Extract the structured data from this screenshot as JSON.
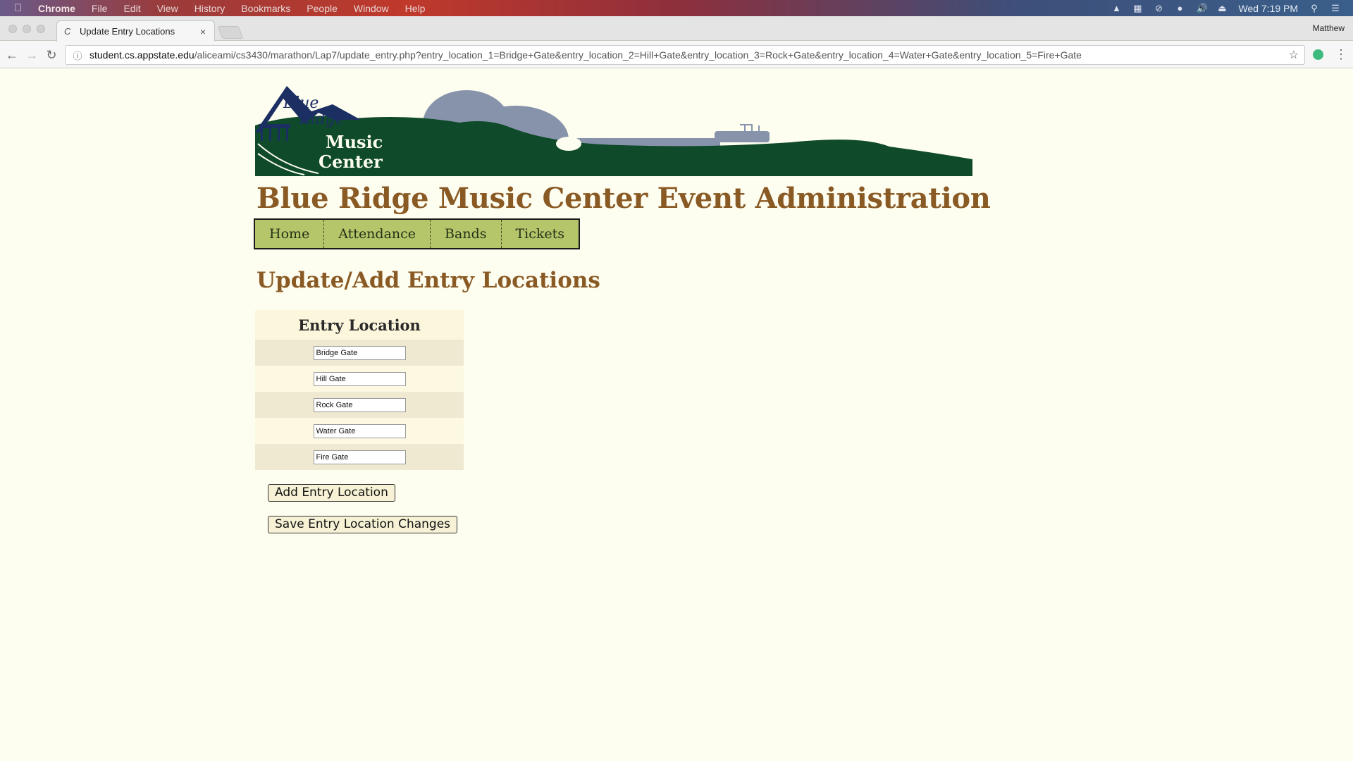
{
  "menubar": {
    "app": "Chrome",
    "items": [
      "File",
      "Edit",
      "View",
      "History",
      "Bookmarks",
      "People",
      "Window",
      "Help"
    ],
    "clock": "Wed 7:19 PM"
  },
  "browser": {
    "tab_title": "Update Entry Locations",
    "profile": "Matthew",
    "url_host": "student.cs.appstate.edu",
    "url_path": "/aliceami/cs3430/marathon/Lap7/update_entry.php?entry_location_1=Bridge+Gate&entry_location_2=Hill+Gate&entry_location_3=Rock+Gate&entry_location_4=Water+Gate&entry_location_5=Fire+Gate"
  },
  "banner": {
    "logo_line1": "Blue",
    "logo_line2": "Ridge",
    "logo_line3": "Music",
    "logo_line4": "Center",
    "colors": {
      "green": "#0f4a2a",
      "guitar": "#8793aa",
      "navy": "#1c2f63"
    }
  },
  "site_title": "Blue Ridge Music Center Event Administration",
  "nav": {
    "home": "Home",
    "attendance": "Attendance",
    "bands": "Bands",
    "tickets": "Tickets"
  },
  "page_heading": "Update/Add Entry Locations",
  "table": {
    "header": "Entry Location",
    "rows": [
      "Bridge Gate",
      "Hill Gate",
      "Rock Gate",
      "Water Gate",
      "Fire Gate"
    ]
  },
  "buttons": {
    "add": "Add Entry Location",
    "save": "Save Entry Location Changes"
  }
}
